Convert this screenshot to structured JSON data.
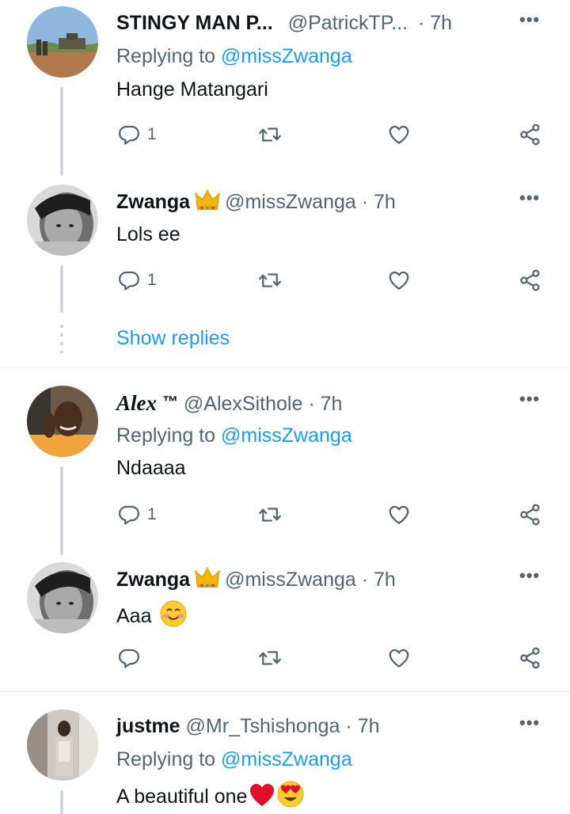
{
  "tweets": [
    {
      "name": "STINGY MAN P...",
      "handle": "@PatrickTP...",
      "time": "· 7h",
      "replying_label": "Replying to",
      "replying_to": "@missZwanga",
      "text": "Hange Matangari",
      "reply_count": "1",
      "more": "•••"
    },
    {
      "name": "Zwanga",
      "handle": "@missZwanga",
      "time": "· 7h",
      "text": "Lols ee",
      "reply_count": "1",
      "more": "•••",
      "show_replies": "Show replies"
    },
    {
      "name": "Alex",
      "name_suffix": "™",
      "handle": "@AlexSithole",
      "time": "· 7h",
      "replying_label": "Replying to",
      "replying_to": "@missZwanga",
      "text": "Ndaaaa",
      "reply_count": "1",
      "more": "•••"
    },
    {
      "name": "Zwanga",
      "handle": "@missZwanga",
      "time": "· 7h",
      "text": "Aaa",
      "reply_count": "",
      "more": "•••"
    },
    {
      "name": "justme",
      "handle": "@Mr_Tshishonga",
      "time": "· 7h",
      "replying_label": "Replying to",
      "replying_to": "@missZwanga",
      "text": "A beautiful one",
      "more": "•••"
    }
  ],
  "icons": {
    "reply": "reply-icon",
    "retweet": "retweet-icon",
    "like": "heart-icon",
    "share": "share-icon",
    "crown": "crown-icon",
    "smile": "smiling-face-emoji",
    "heart_emoji": "red-heart-emoji",
    "heart_eyes": "heart-eyes-emoji"
  },
  "colors": {
    "link": "#1d9bf0",
    "secondary": "#536471",
    "thread": "#cfd9de"
  }
}
